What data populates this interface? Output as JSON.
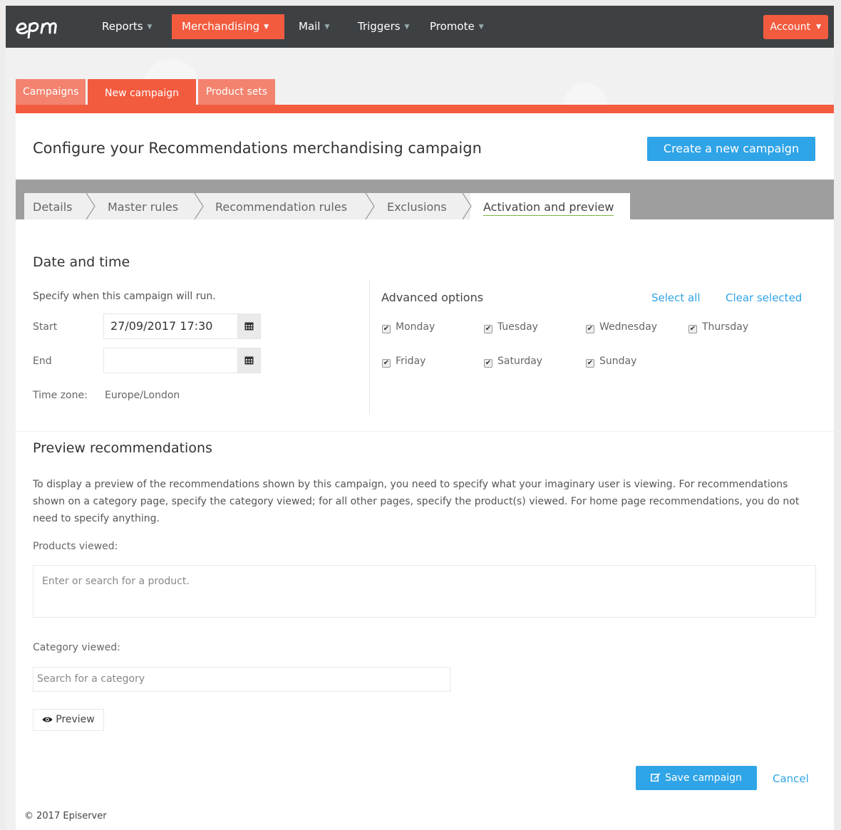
{
  "nav": {
    "items": [
      {
        "label": "Reports"
      },
      {
        "label": "Merchandising"
      },
      {
        "label": "Mail"
      },
      {
        "label": "Triggers"
      },
      {
        "label": "Promote"
      }
    ],
    "account": "Account"
  },
  "tabs": [
    {
      "label": "Campaigns"
    },
    {
      "label": "New campaign"
    },
    {
      "label": "Product sets"
    }
  ],
  "page": {
    "title": "Configure your Recommendations merchandising campaign",
    "create_button": "Create a new campaign"
  },
  "steps": [
    {
      "label": "Details"
    },
    {
      "label": "Master rules"
    },
    {
      "label": "Recommendation rules"
    },
    {
      "label": "Exclusions"
    },
    {
      "label": "Activation and preview"
    }
  ],
  "datetime": {
    "heading": "Date and time",
    "intro": "Specify when this campaign will run.",
    "start_label": "Start",
    "start_value": "27/09/2017  17:30",
    "end_label": "End",
    "end_value": "",
    "tz_label": "Time zone:",
    "tz_value": "Europe/London"
  },
  "advanced": {
    "heading": "Advanced options",
    "select_all": "Select all",
    "clear_selected": "Clear selected",
    "days": [
      {
        "label": "Monday",
        "checked": true
      },
      {
        "label": "Tuesday",
        "checked": true
      },
      {
        "label": "Wednesday",
        "checked": true
      },
      {
        "label": "Thursday",
        "checked": true
      },
      {
        "label": "Friday",
        "checked": true
      },
      {
        "label": "Saturday",
        "checked": true
      },
      {
        "label": "Sunday",
        "checked": true
      }
    ]
  },
  "preview": {
    "heading": "Preview recommendations",
    "paragraph": "To display a preview of the recommendations shown by this campaign, you need to specify what your imaginary user is viewing. For recommendations shown on a category page, specify the category viewed; for all other pages, specify the product(s) viewed. For home page recommendations, you do not need to specify anything.",
    "products_label": "Products viewed:",
    "products_placeholder": "Enter or search for a product.",
    "category_label": "Category viewed:",
    "category_placeholder": "Search for a category",
    "preview_button": "Preview"
  },
  "actions": {
    "save": "Save campaign",
    "cancel": "Cancel"
  },
  "footer": "© 2017 Episerver",
  "colors": {
    "brand": "#f35b3f",
    "brand_light": "#f3836f",
    "nav_bg": "#3d4144",
    "primary": "#2fa4e7"
  }
}
